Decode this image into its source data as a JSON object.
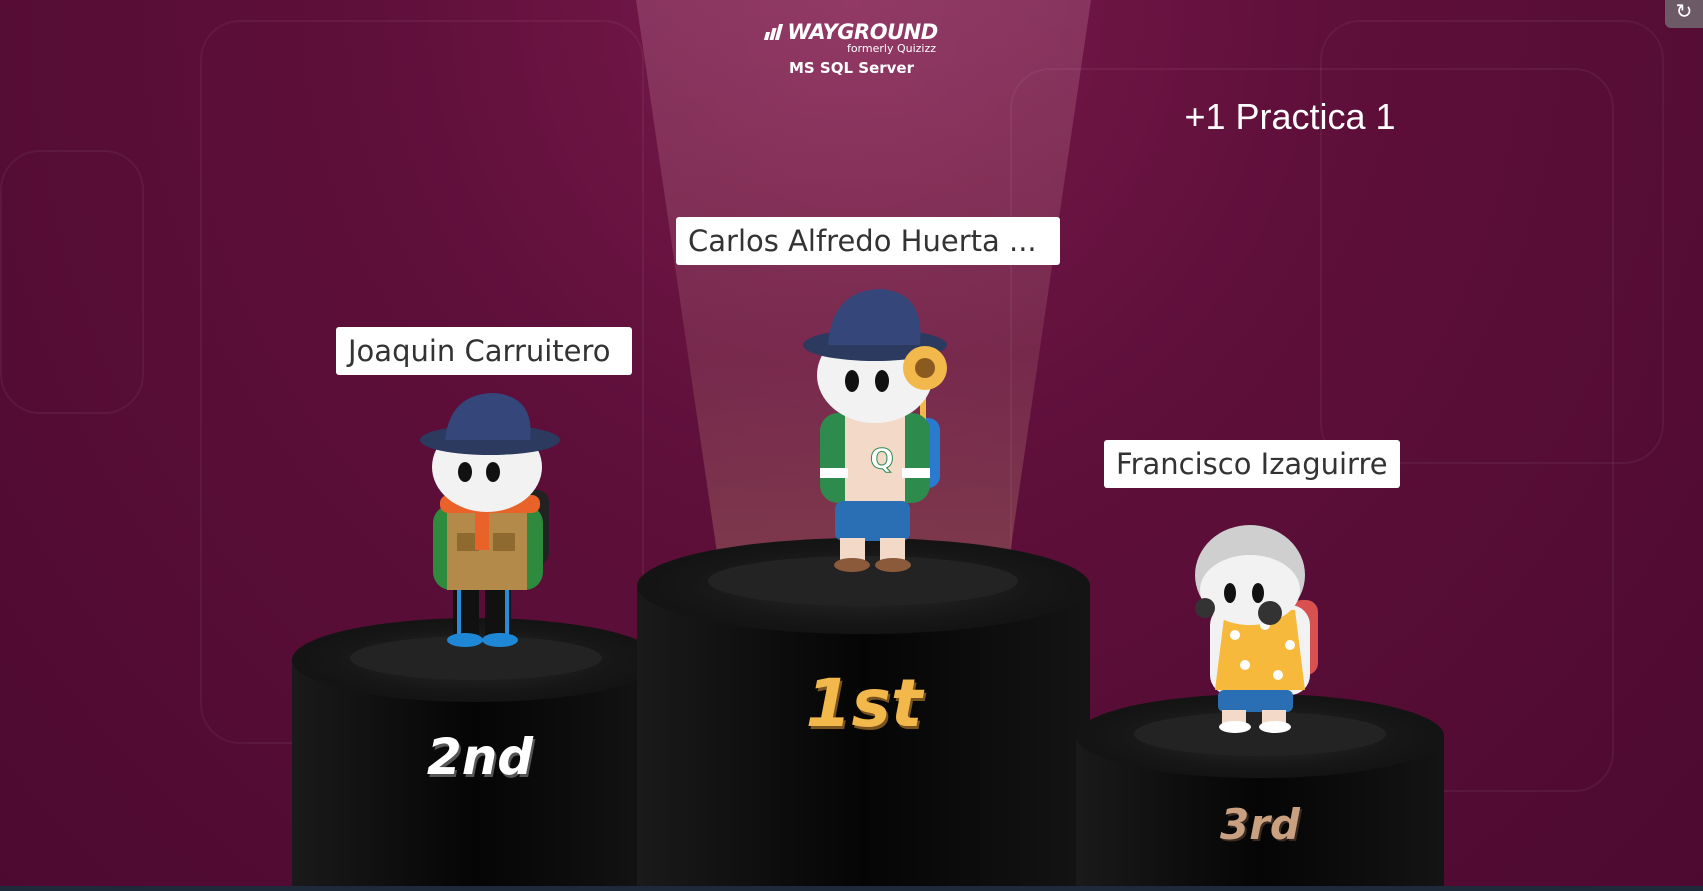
{
  "brand": {
    "name": "WAYGROUND",
    "subtitle": "formerly Quizizz",
    "course": "MS SQL Server"
  },
  "practice_label": "+1 Practica 1",
  "podium": {
    "first": {
      "name": "Carlos Alfredo Huerta ...",
      "rank": "1st",
      "rank_color": "#f2b84b"
    },
    "second": {
      "name": "Joaquin Carruitero",
      "rank": "2nd",
      "rank_color": "#ffffff"
    },
    "third": {
      "name": "Francisco Izaguirre",
      "rank": "3rd",
      "rank_color": "#c9a080"
    }
  },
  "icons": {
    "corner": "refresh-icon",
    "hat": "bucket-hat-icon",
    "flower": "sunflower-icon"
  },
  "colors": {
    "background": "#5e0f3a",
    "podium": "#0a0a0a",
    "gold": "#f2b84b"
  }
}
